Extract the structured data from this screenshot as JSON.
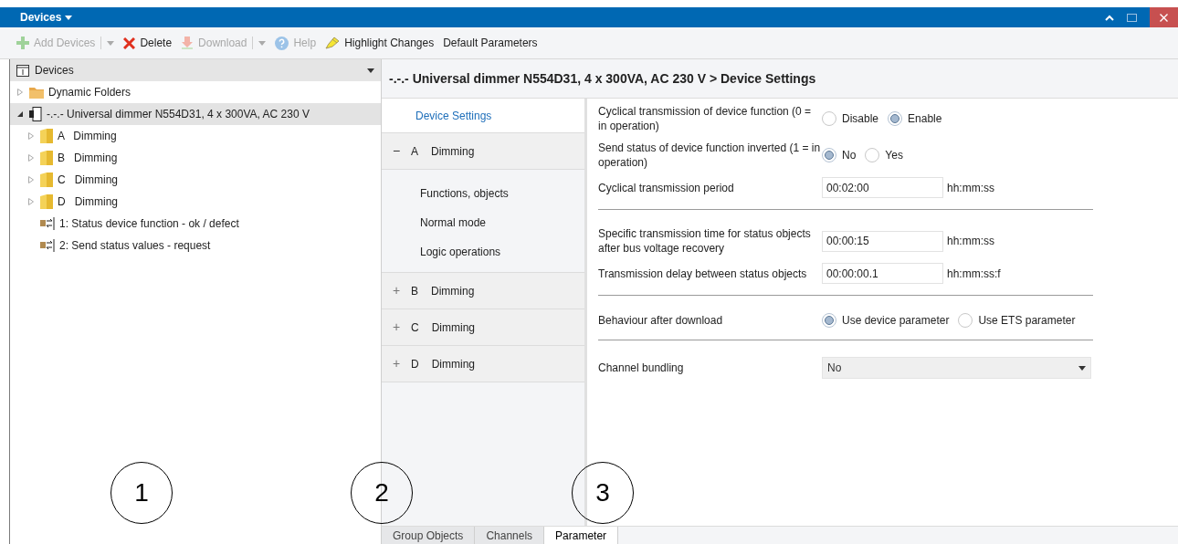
{
  "window": {
    "title": "Devices"
  },
  "toolbar": [
    {
      "label": "Add Devices",
      "kind": "add",
      "disabled": true,
      "dropdown": true
    },
    {
      "label": "Delete",
      "kind": "delete",
      "disabled": false,
      "dropdown": false
    },
    {
      "label": "Download",
      "kind": "download",
      "disabled": true,
      "dropdown": true
    },
    {
      "label": "Help",
      "kind": "help",
      "disabled": true,
      "dropdown": false
    },
    {
      "label": "Highlight Changes",
      "kind": "highlight",
      "disabled": false,
      "dropdown": false
    },
    {
      "label": "Default Parameters",
      "kind": "none",
      "disabled": false,
      "dropdown": false
    }
  ],
  "sidebar": {
    "title": "Devices",
    "items": [
      {
        "label": "Dynamic Folders",
        "kind": "folder-orange",
        "selected": false,
        "expanded": false
      },
      {
        "label": "-.-.- Universal dimmer N554D31, 4 x 300VA, AC 230 V",
        "kind": "device",
        "selected": true,
        "expanded": true,
        "children": [
          {
            "label": "A   Dimming",
            "kind": "folder",
            "selected": false,
            "expanded": false
          },
          {
            "label": "B   Dimming",
            "kind": "folder",
            "selected": false,
            "expanded": false
          },
          {
            "label": "C   Dimming",
            "kind": "folder",
            "selected": false,
            "expanded": false
          },
          {
            "label": "D   Dimming",
            "kind": "folder",
            "selected": false,
            "expanded": false
          },
          {
            "label": "1: Status device function - ok / defect",
            "kind": "object",
            "selected": false
          },
          {
            "label": "2: Send status values - request",
            "kind": "object",
            "selected": false
          }
        ]
      }
    ]
  },
  "breadcrumb": "-.-.- Universal dimmer N554D31, 4 x 300VA, AC 230 V > Device Settings",
  "nav": [
    {
      "kind": "link",
      "label": "Device Settings",
      "selected": true
    },
    {
      "kind": "group",
      "toggle": "−",
      "letter": "A",
      "label": "Dimming",
      "expanded": true,
      "children": [
        "Functions, objects",
        "Normal mode",
        "Logic operations"
      ]
    },
    {
      "kind": "group",
      "toggle": "+",
      "letter": "B",
      "label": "Dimming",
      "expanded": false
    },
    {
      "kind": "group",
      "toggle": "+",
      "letter": "C",
      "label": "Dimming",
      "expanded": false
    },
    {
      "kind": "group",
      "toggle": "+",
      "letter": "D",
      "label": "Dimming",
      "expanded": false
    }
  ],
  "sections": [
    [
      {
        "kind": "radio",
        "label": "Cyclical transmission of device function (0 = in operation)",
        "options": [
          {
            "label": "Disable",
            "selected": false
          },
          {
            "label": "Enable",
            "selected": true
          }
        ]
      },
      {
        "kind": "radio",
        "label": "Send status of device function inverted (1 = in operation)",
        "options": [
          {
            "label": "No",
            "selected": true
          },
          {
            "label": "Yes",
            "selected": false
          }
        ]
      },
      {
        "kind": "input",
        "label": "Cyclical transmission period",
        "value": "00:02:00",
        "unit": "hh:mm:ss"
      }
    ],
    [
      {
        "kind": "input",
        "label": "Specific transmission time for status objects after bus voltage recovery",
        "value": "00:00:15",
        "unit": "hh:mm:ss"
      },
      {
        "kind": "input",
        "label": "Transmission delay between status objects",
        "value": "00:00:00.1",
        "unit": "hh:mm:ss:f"
      }
    ],
    [
      {
        "kind": "radio",
        "label": "Behaviour after download",
        "options": [
          {
            "label": "Use device parameter",
            "selected": true
          },
          {
            "label": "Use ETS parameter",
            "selected": false
          }
        ]
      }
    ],
    [
      {
        "kind": "select",
        "label": "Channel bundling",
        "value": "No"
      }
    ]
  ],
  "bottom_tabs": [
    {
      "label": "Group Objects",
      "selected": false
    },
    {
      "label": "Channels",
      "selected": false
    },
    {
      "label": "Parameter",
      "selected": true
    }
  ],
  "callouts": [
    "1",
    "2",
    "3"
  ]
}
